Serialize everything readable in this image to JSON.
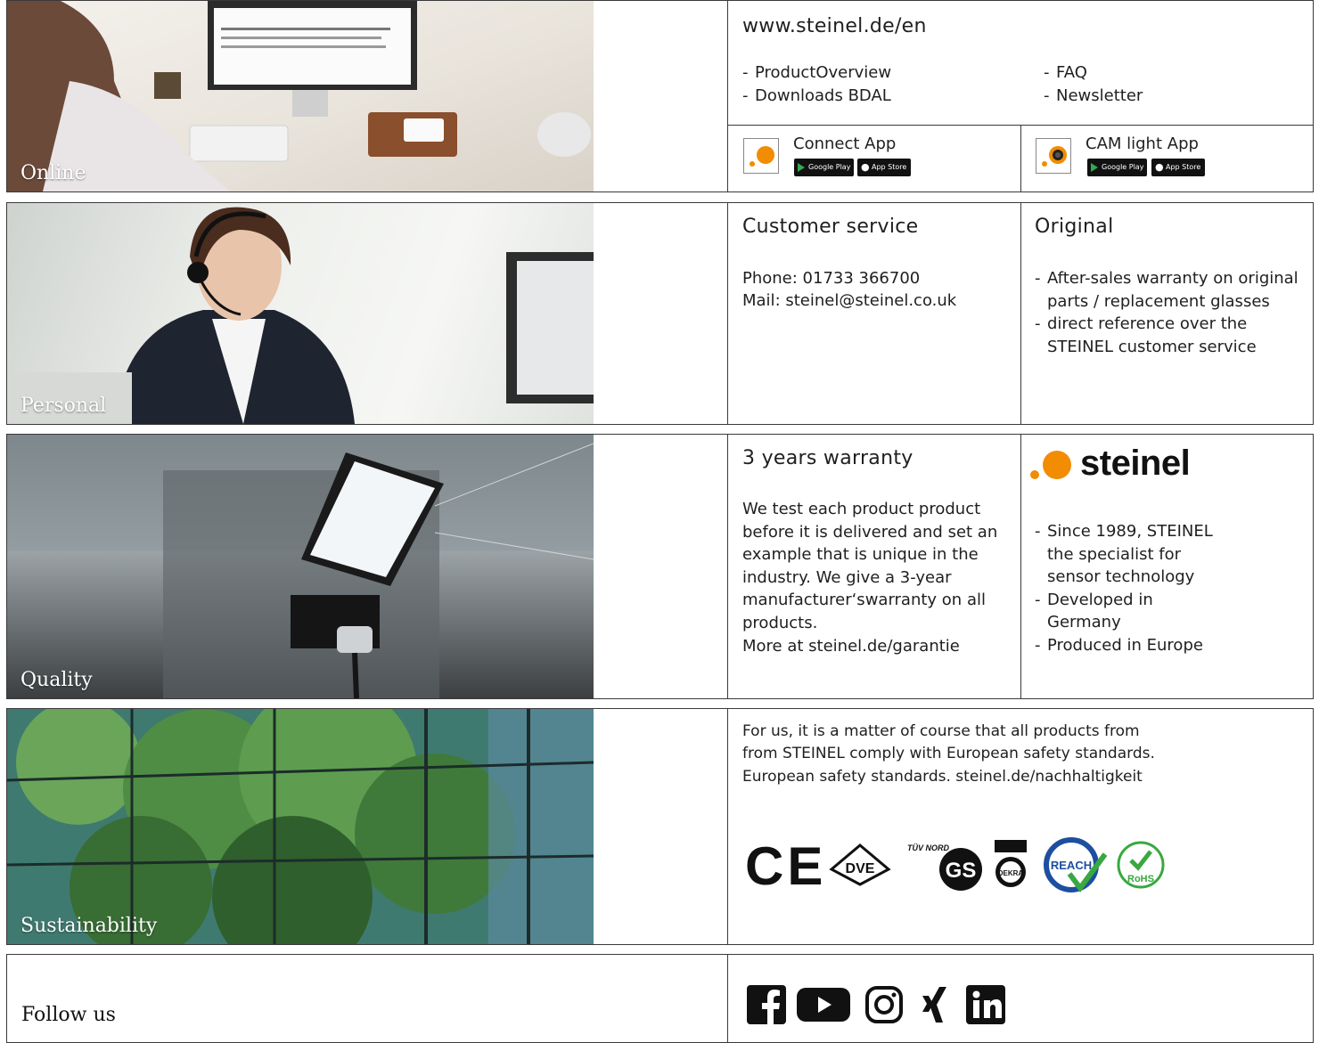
{
  "online": {
    "label": "Online",
    "url": "www.steinel.de/en",
    "links_left": [
      "ProductOverview",
      "Downloads BDAL"
    ],
    "links_right": [
      "FAQ",
      "Newsletter"
    ],
    "apps": [
      {
        "name": "Connect App",
        "icon": "steinel-dot-icon",
        "badges": [
          "Google Play",
          "App Store"
        ]
      },
      {
        "name": "CAM light App",
        "icon": "camera-icon",
        "badges": [
          "Google Play",
          "App Store"
        ]
      }
    ]
  },
  "personal": {
    "label": "Personal",
    "service_title": "Customer service",
    "phone": "Phone: 01733 366700",
    "mail": "Mail: steinel@steinel.co.uk",
    "original_title": "Original",
    "original_items": [
      "After-sales warranty on original parts / replacement glasses",
      "direct reference over the STEINEL customer service"
    ]
  },
  "quality": {
    "label": "Quality",
    "warranty_title": "3 years warranty",
    "warranty_text": "We test each product product before it is delivered and set an example that is unique in the industry. We give a 3-year manufacturer‘swarranty on all products.",
    "warranty_more": "More at steinel.de/garantie",
    "brand": "steinel",
    "brand_items": [
      "Since 1989, STEINEL the specialist for sensor technology",
      "Developed in Germany",
      "Produced in Europe"
    ]
  },
  "sustainability": {
    "label": "Sustainability",
    "text_lines": [
      "For us, it is a matter of course that all products from",
      "from STEINEL comply with European safety standards.",
      "European safety standards. steinel.de/nachhaltigkeit"
    ],
    "certifications": [
      "CE",
      "VDE",
      "TÜV NORD GS",
      "DEKRA",
      "REACH",
      "RoHS"
    ]
  },
  "follow": {
    "label": "Follow us",
    "socials": [
      "facebook-icon",
      "youtube-icon",
      "instagram-icon",
      "xing-icon",
      "linkedin-icon"
    ]
  },
  "colors": {
    "accent": "#f28c00",
    "border": "#3a3a3a"
  }
}
